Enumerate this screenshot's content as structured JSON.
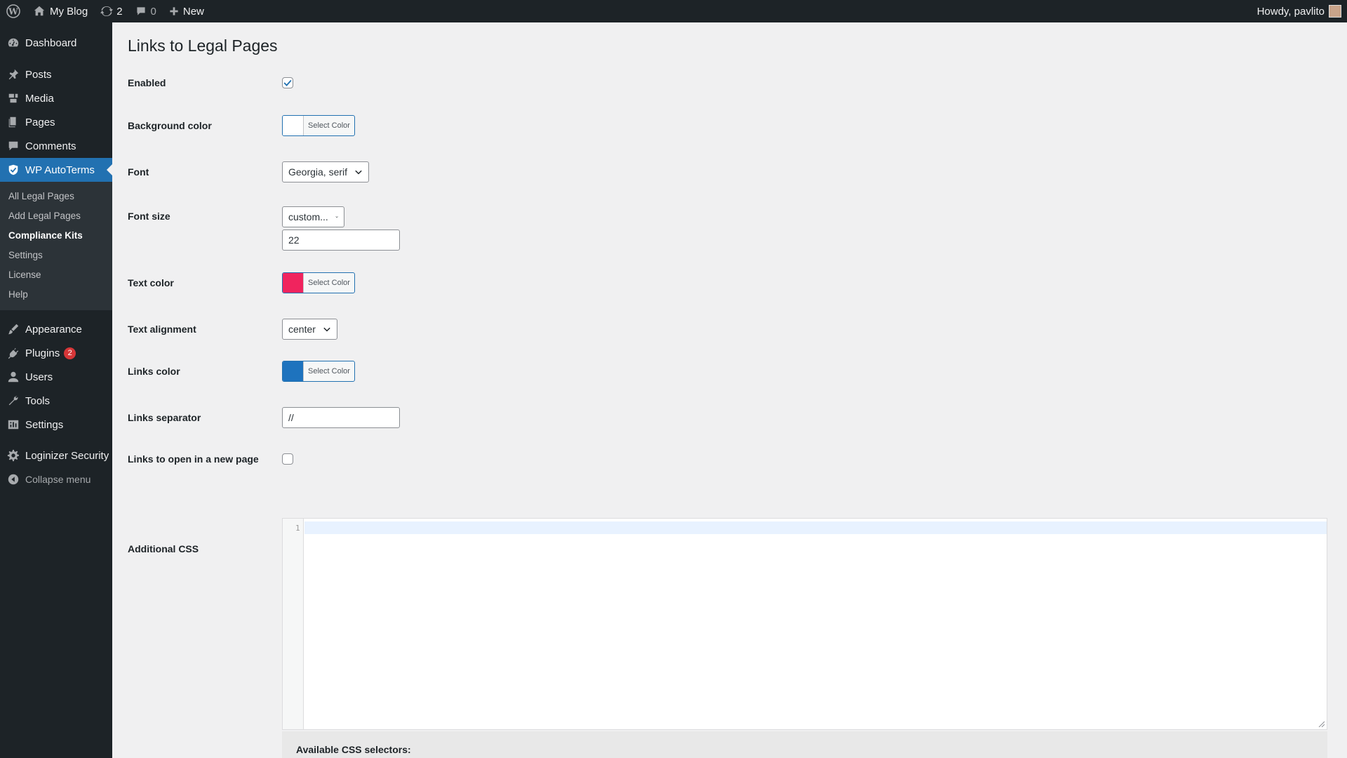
{
  "adminbar": {
    "site_name": "My Blog",
    "updates_count": "2",
    "comments_count": "0",
    "new_label": "New",
    "howdy": "Howdy, pavlito"
  },
  "sidebar": {
    "items_top": [
      {
        "label": "Dashboard",
        "icon": "dashboard-icon"
      },
      {
        "label": "Posts",
        "icon": "pin-icon"
      },
      {
        "label": "Media",
        "icon": "media-icon"
      },
      {
        "label": "Pages",
        "icon": "pages-icon"
      },
      {
        "label": "Comments",
        "icon": "comment-icon"
      },
      {
        "label": "WP AutoTerms",
        "icon": "autoterms-icon"
      }
    ],
    "submenu": [
      "All Legal Pages",
      "Add Legal Pages",
      "Compliance Kits",
      "Settings",
      "License",
      "Help"
    ],
    "items_bottom": [
      {
        "label": "Appearance",
        "icon": "brush-icon"
      },
      {
        "label": "Plugins",
        "icon": "plugin-icon",
        "badge": "2"
      },
      {
        "label": "Users",
        "icon": "user-icon"
      },
      {
        "label": "Tools",
        "icon": "wrench-icon"
      },
      {
        "label": "Settings",
        "icon": "settings-icon"
      },
      {
        "label": "Loginizer Security",
        "icon": "gear-icon"
      },
      {
        "label": "Collapse menu",
        "icon": "collapse-icon"
      }
    ],
    "active": "WP AutoTerms",
    "current_sub": "Compliance Kits"
  },
  "page": {
    "title": "Links to Legal Pages",
    "enabled_label": "Enabled",
    "enabled": true,
    "bg_color_label": "Background color",
    "bg_color": "#ffffff",
    "select_color": "Select Color",
    "font_label": "Font",
    "font_value": "Georgia, serif",
    "font_size_label": "Font size",
    "font_size_select": "custom...",
    "font_size_value": "22",
    "text_color_label": "Text color",
    "text_color": "#f0245e",
    "text_align_label": "Text alignment",
    "text_align_value": "center",
    "links_color_label": "Links color",
    "links_color": "#1e73be",
    "separator_label": "Links separator",
    "separator_value": "//",
    "new_page_label": "Links to open in a new page",
    "new_page": false,
    "css_label": "Additional CSS",
    "css_line_number": "1",
    "selectors_label": "Available CSS selectors:"
  }
}
